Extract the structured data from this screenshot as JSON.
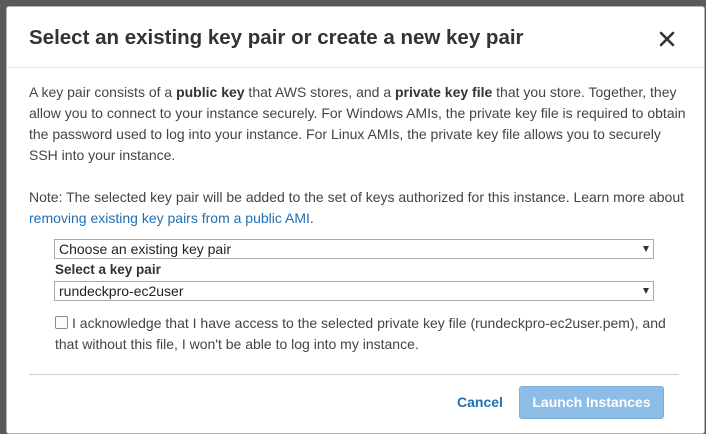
{
  "modal": {
    "title": "Select an existing key pair or create a new key pair",
    "close_label": "×"
  },
  "intro": {
    "t1": "A key pair consists of a ",
    "b1": "public key",
    "t2": " that AWS stores, and a ",
    "b2": "private key file",
    "t3": " that you store. Together, they allow you to connect to your instance securely. For Windows AMIs, the private key file is required to obtain the password used to log into your instance. For Linux AMIs, the private key file allows you to securely SSH into your instance."
  },
  "note": {
    "text": "Note: The selected key pair will be added to the set of keys authorized for this instance. Learn more about ",
    "link": "removing existing key pairs from a public AMI",
    "end": "."
  },
  "mode_select": {
    "value": "Choose an existing key pair"
  },
  "key_select": {
    "label": "Select a key pair",
    "value": "rundeckpro-ec2user"
  },
  "acknowledge": {
    "text": "I acknowledge that I have access to the selected private key file (rundeckpro-ec2user.pem), and that without this file, I won't be able to log into my instance.",
    "checked": false
  },
  "footer": {
    "cancel_label": "Cancel",
    "launch_label": "Launch Instances"
  },
  "colors": {
    "link": "#1f6fb5",
    "launch_button_disabled": "#8cbde6"
  }
}
